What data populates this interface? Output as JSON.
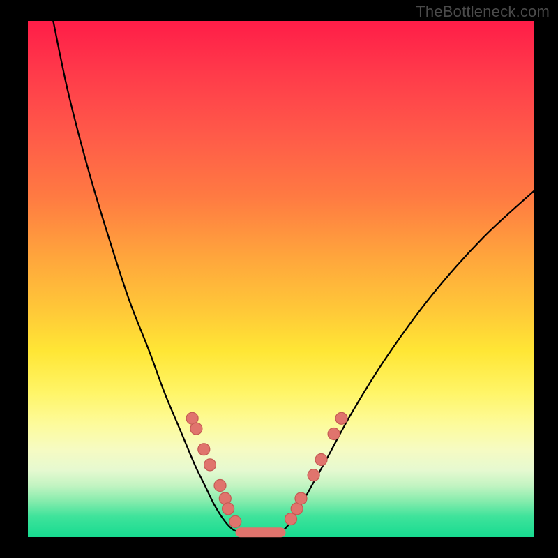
{
  "watermark": "TheBottleneck.com",
  "colors": {
    "background_frame": "#000000",
    "gradient_top": "#ff1d48",
    "gradient_bottom": "#17db90",
    "curve": "#000000",
    "marker_fill": "#e0746d",
    "marker_stroke": "#c45a53"
  },
  "chart_data": {
    "type": "line",
    "title": "",
    "xlabel": "",
    "ylabel": "",
    "xlim": [
      0,
      100
    ],
    "ylim": [
      0,
      100
    ],
    "background": "vertical-rainbow-gradient (red top → green bottom)",
    "series": [
      {
        "name": "left-curve",
        "x": [
          5,
          8,
          12,
          16,
          20,
          24,
          27,
          30,
          33,
          35,
          37,
          39,
          40.5,
          42
        ],
        "y": [
          100,
          86,
          71,
          58,
          46,
          36,
          28,
          21,
          14,
          10,
          6,
          3,
          1.5,
          0.8
        ]
      },
      {
        "name": "flat-bottom",
        "x": [
          42,
          44,
          46,
          48,
          50
        ],
        "y": [
          0.8,
          0.6,
          0.6,
          0.6,
          0.8
        ]
      },
      {
        "name": "right-curve",
        "x": [
          50,
          52,
          55,
          59,
          64,
          71,
          80,
          90,
          100
        ],
        "y": [
          0.8,
          3,
          8,
          15,
          24,
          35,
          47,
          58,
          67
        ]
      }
    ],
    "markers": {
      "name": "overlay-dots",
      "points": [
        {
          "x": 32.5,
          "y": 23
        },
        {
          "x": 33.3,
          "y": 21
        },
        {
          "x": 34.8,
          "y": 17
        },
        {
          "x": 36.0,
          "y": 14
        },
        {
          "x": 38.0,
          "y": 10
        },
        {
          "x": 39.0,
          "y": 7.5
        },
        {
          "x": 39.6,
          "y": 5.5
        },
        {
          "x": 41.0,
          "y": 3
        },
        {
          "x": 52.0,
          "y": 3.5
        },
        {
          "x": 53.2,
          "y": 5.5
        },
        {
          "x": 54.0,
          "y": 7.5
        },
        {
          "x": 56.5,
          "y": 12
        },
        {
          "x": 58.0,
          "y": 15
        },
        {
          "x": 60.5,
          "y": 20
        },
        {
          "x": 62.0,
          "y": 23
        }
      ]
    },
    "flat_segment": {
      "x0": 42,
      "x1": 50,
      "y": 0.9
    }
  }
}
